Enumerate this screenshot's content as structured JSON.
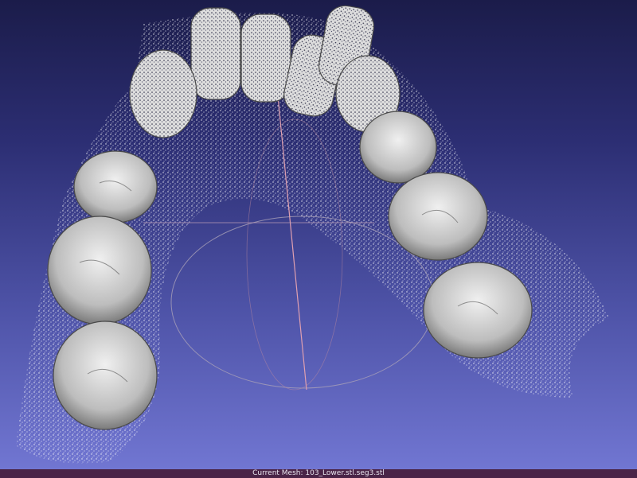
{
  "window": {
    "background_top": "#1b1c4a",
    "background_bottom": "#7176d2"
  },
  "scene": {
    "object": "lower-dental-arch-point-cloud",
    "mesh_color": "#d8d8d8",
    "point_color": "#ffffff",
    "trackball_visible": true
  },
  "status_bar": {
    "text": "Current Mesh: 103_Lower.stl.seg3.stl",
    "background": "#4a2447"
  }
}
